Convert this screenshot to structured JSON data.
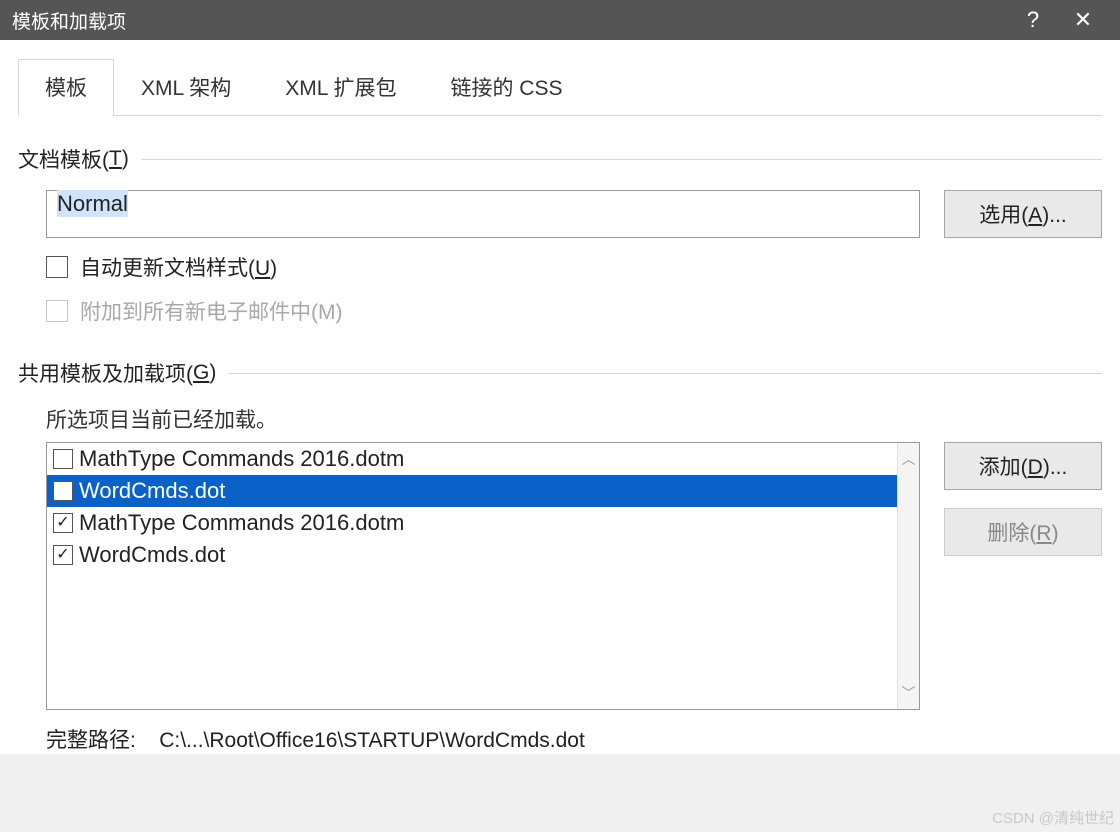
{
  "titlebar": {
    "title": "模板和加载项",
    "help": "?",
    "close": "✕"
  },
  "tabs": [
    {
      "label": "模板",
      "active": true
    },
    {
      "label": "XML 架构",
      "active": false
    },
    {
      "label": "XML 扩展包",
      "active": false
    },
    {
      "label": "链接的 CSS",
      "active": false
    }
  ],
  "doc_template": {
    "header_pre": "文档模板(",
    "header_ul": "T",
    "header_post": ")",
    "value": "Normal",
    "attach_btn_pre": "选用(",
    "attach_btn_ul": "A",
    "attach_btn_post": ")...",
    "auto_update_pre": "自动更新文档样式(",
    "auto_update_ul": "U",
    "auto_update_post": ")",
    "attach_all_email_checked": false,
    "attach_all_email": "附加到所有新电子邮件中(M)"
  },
  "global": {
    "header_pre": "共用模板及加载项(",
    "header_ul": "G",
    "header_post": ")",
    "hint": "所选项目当前已经加载。",
    "items": [
      {
        "label": "MathType Commands 2016.dotm",
        "checked": false,
        "selected": false
      },
      {
        "label": "WordCmds.dot",
        "checked": true,
        "selected": true
      },
      {
        "label": "MathType Commands 2016.dotm",
        "checked": true,
        "selected": false
      },
      {
        "label": "WordCmds.dot",
        "checked": true,
        "selected": false
      }
    ],
    "add_btn_pre": "添加(",
    "add_btn_ul": "D",
    "add_btn_post": ")...",
    "remove_btn_pre": "删除(",
    "remove_btn_ul": "R",
    "remove_btn_post": ")",
    "full_path_label": "完整路径:",
    "full_path_value": "C:\\...\\Root\\Office16\\STARTUP\\WordCmds.dot"
  },
  "watermark": "CSDN @清纯世纪"
}
